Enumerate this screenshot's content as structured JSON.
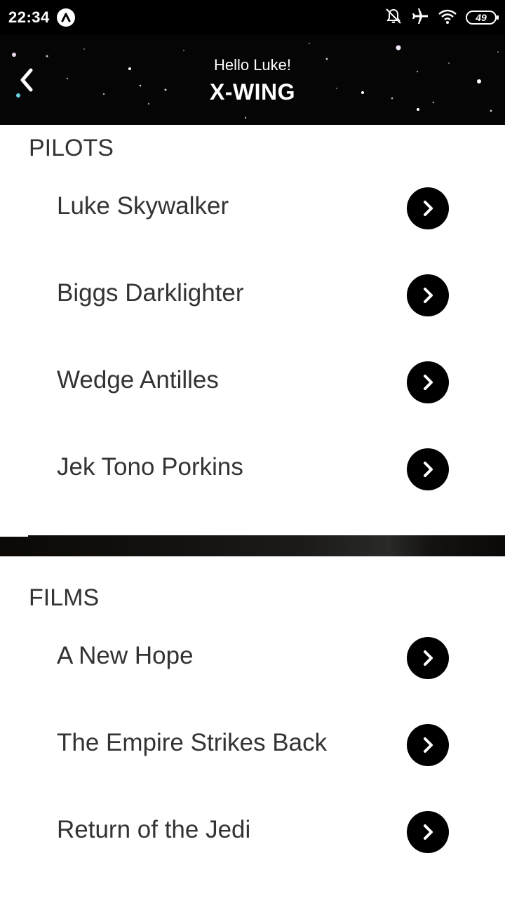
{
  "status_bar": {
    "time": "22:34",
    "app_icon": "app-a-icon",
    "icons": [
      "notifications-muted-icon",
      "airplane-mode-icon",
      "wifi-icon"
    ],
    "battery": "49"
  },
  "header": {
    "back_icon": "chevron-left-icon",
    "greeting": "Hello Luke!",
    "title": "X-WING"
  },
  "pilots": {
    "title": "PILOTS",
    "items": [
      {
        "label": "Luke Skywalker"
      },
      {
        "label": "Biggs Darklighter"
      },
      {
        "label": "Wedge Antilles"
      },
      {
        "label": "Jek Tono Porkins"
      }
    ]
  },
  "films": {
    "title": "FILMS",
    "items": [
      {
        "label": "A New Hope"
      },
      {
        "label": "The Empire Strikes Back"
      },
      {
        "label": "Return of the Jedi"
      }
    ]
  },
  "row_action_icon": "chevron-right-icon",
  "colors": {
    "header_background": "#050505",
    "text": "#333333",
    "action_button": "#000000"
  }
}
